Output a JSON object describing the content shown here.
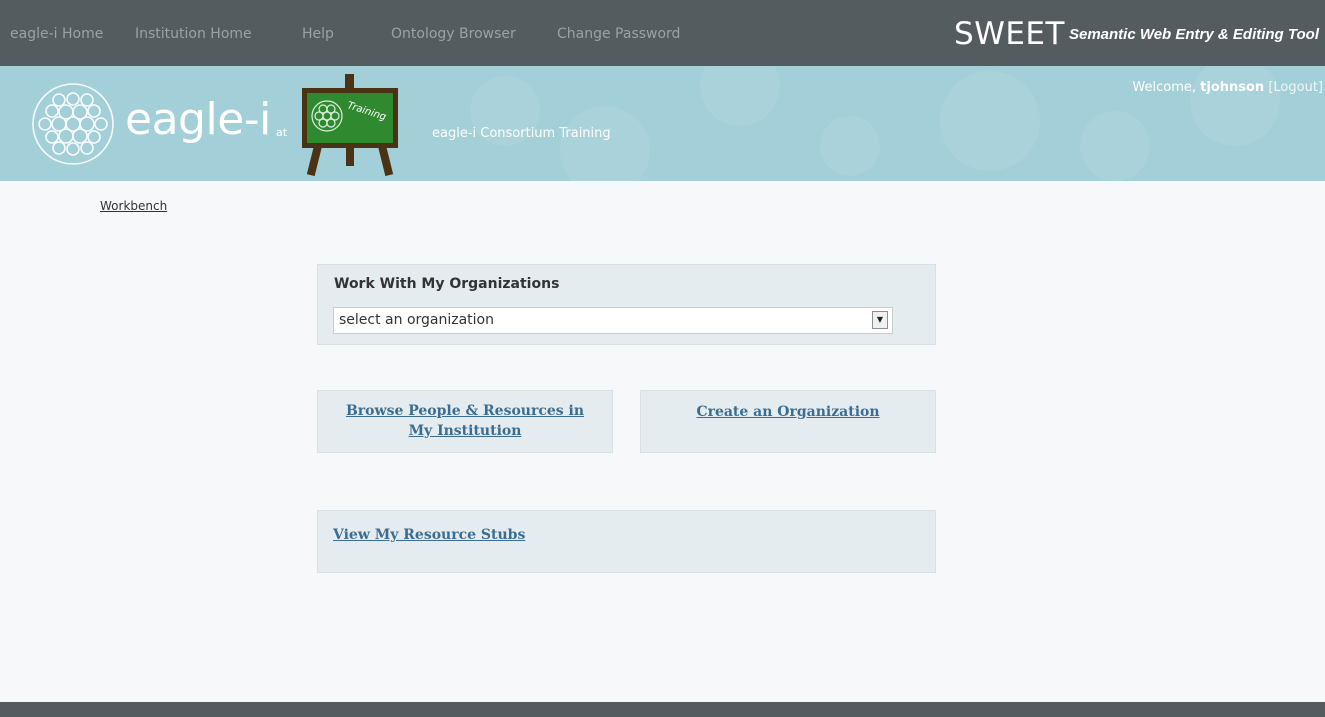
{
  "nav": {
    "items": [
      "eagle-i Home",
      "Institution Home",
      "Help",
      "Ontology Browser",
      "Change Password"
    ]
  },
  "brand": {
    "title": "SWEET",
    "subtitle": "Semantic Web Entry & Editing Tool"
  },
  "banner": {
    "logo_text": "eagle-i",
    "at_label": "at",
    "easel_text": "Training",
    "site_name": "eagle-i Consortium Training",
    "welcome_prefix": "Welcome, ",
    "username": "tjohnson",
    "logout_label": "[Logout]"
  },
  "breadcrumb": {
    "workbench": "Workbench"
  },
  "orgs_panel": {
    "title": "Work With My Organizations",
    "select_value": "select an organization"
  },
  "actions": {
    "browse_label": "Browse People & Resources in My Institution",
    "create_label": "Create an Organization",
    "stubs_label": "View My Resource Stubs"
  },
  "colors": {
    "nav_bg": "#555c5f",
    "banner_bg": "#a3cfd9",
    "panel_bg": "#e4ecef",
    "link": "#3c6d90"
  }
}
